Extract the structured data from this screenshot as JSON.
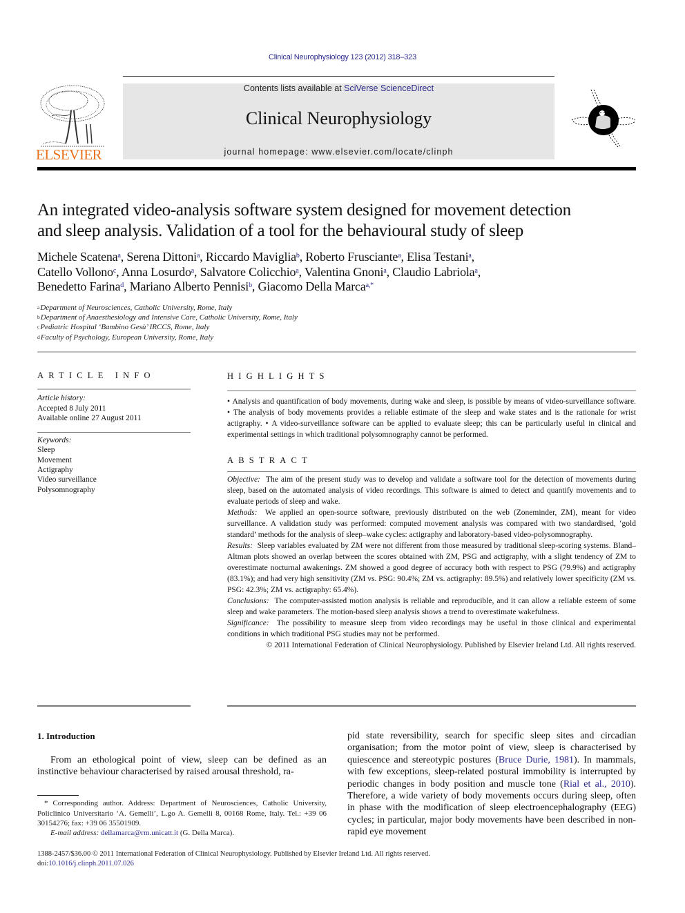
{
  "header": {
    "journal_ref": "Clinical Neurophysiology 123 (2012) 318–323",
    "publisher_logo_text": "ELSEVIER",
    "contents_prefix": "Contents lists available at ",
    "contents_link": "SciVerse ScienceDirect",
    "journal_title": "Clinical Neurophysiology",
    "homepage_prefix": "journal homepage: ",
    "homepage_url_text": "www.elsevier.com/locate/clinph"
  },
  "article": {
    "title_line1": "An integrated video-analysis software system designed for movement detection",
    "title_line2": "and sleep analysis. Validation of a tool for the behavioural study of sleep",
    "authors": [
      {
        "name": "Michele Scatena",
        "aff": "a",
        "sep": ", "
      },
      {
        "name": "Serena Dittoni",
        "aff": "a",
        "sep": ", "
      },
      {
        "name": "Riccardo Maviglia",
        "aff": "b",
        "sep": ", "
      },
      {
        "name": "Roberto Frusciante",
        "aff": "a",
        "sep": ", "
      },
      {
        "name": "Elisa Testani",
        "aff": "a",
        "sep": ","
      },
      {
        "name": "Catello Vollono",
        "aff": "c",
        "sep": ", "
      },
      {
        "name": "Anna Losurdo",
        "aff": "a",
        "sep": ", "
      },
      {
        "name": "Salvatore Colicchio",
        "aff": "a",
        "sep": ", "
      },
      {
        "name": "Valentina Gnoni",
        "aff": "a",
        "sep": ", "
      },
      {
        "name": "Claudio Labriola",
        "aff": "a",
        "sep": ","
      },
      {
        "name": "Benedetto Farina",
        "aff": "d",
        "sep": ", "
      },
      {
        "name": "Mariano Alberto Pennisi",
        "aff": "b",
        "sep": ", "
      },
      {
        "name": "Giacomo Della Marca",
        "aff": "a,*",
        "sep": ""
      }
    ],
    "affiliations": [
      {
        "key": "a",
        "text": "Department of Neurosciences, Catholic University, Rome, Italy"
      },
      {
        "key": "b",
        "text": "Department of Anaesthesiology and Intensive Care, Catholic University, Rome, Italy"
      },
      {
        "key": "c",
        "text": "Pediatric Hospital ‘Bambino Gesù’ IRCCS, Rome, Italy"
      },
      {
        "key": "d",
        "text": "Faculty of Psychology, European University, Rome, Italy"
      }
    ]
  },
  "article_info": {
    "heading": "ARTICLE INFO",
    "history_label": "Article history:",
    "accepted": "Accepted 8 July 2011",
    "online": "Available online 27 August 2011",
    "keywords_label": "Keywords:",
    "keywords": [
      "Sleep",
      "Movement",
      "Actigraphy",
      "Video surveillance",
      "Polysomnography"
    ]
  },
  "highlights": {
    "heading": "HIGHLIGHTS",
    "items": [
      "Analysis and quantification of body movements, during wake and sleep, is possible by means of video-surveillance software.",
      "The analysis of body movements provides a reliable estimate of the sleep and wake states and is the rationale for wrist actigraphy.",
      "A video-surveillance software can be applied to evaluate sleep; this can be particularly useful in clinical and experimental settings in which traditional polysomnography cannot be performed."
    ]
  },
  "abstract": {
    "heading": "ABSTRACT",
    "sections": [
      {
        "label": "Objective:",
        "text": "The aim of the present study was to develop and validate a software tool for the detection of movements during sleep, based on the automated analysis of video recordings. This software is aimed to detect and quantify movements and to evaluate periods of sleep and wake."
      },
      {
        "label": "Methods:",
        "text": "We applied an open-source software, previously distributed on the web (Zoneminder, ZM), meant for video surveillance. A validation study was performed: computed movement analysis was compared with two standardised, ‘gold standard’ methods for the analysis of sleep–wake cycles: actigraphy and laboratory-based video-polysomnography."
      },
      {
        "label": "Results:",
        "text": "Sleep variables evaluated by ZM were not different from those measured by traditional sleep-scoring systems. Bland–Altman plots showed an overlap between the scores obtained with ZM, PSG and actigraphy, with a slight tendency of ZM to overestimate nocturnal awakenings. ZM showed a good degree of accuracy both with respect to PSG (79.9%) and actigraphy (83.1%); and had very high sensitivity (ZM vs. PSG: 90.4%; ZM vs. actigraphy: 89.5%) and relatively lower specificity (ZM vs. PSG: 42.3%; ZM vs. actigraphy: 65.4%)."
      },
      {
        "label": "Conclusions:",
        "text": "The computer-assisted motion analysis is reliable and reproducible, and it can allow a reliable esteem of some sleep and wake parameters. The motion-based sleep analysis shows a trend to overestimate wakefulness."
      },
      {
        "label": "Significance:",
        "text": "The possibility to measure sleep from video recordings may be useful in those clinical and experimental conditions in which traditional PSG studies may not be performed."
      }
    ],
    "copyright": "© 2011 International Federation of Clinical Neurophysiology. Published by Elsevier Ireland Ltd. All rights reserved."
  },
  "introduction": {
    "heading": "1. Introduction",
    "left_para": "From an ethological point of view, sleep can be defined as an instinctive behaviour characterised by raised arousal threshold, ra-",
    "right_parts": {
      "p1": "pid state reversibility, search for specific sleep sites and circadian organisation; from the motor point of view, sleep is characterised by quiescence and stereotypic postures (",
      "ref1": "Bruce Durie, 1981",
      "p2": "). In mammals, with few exceptions, sleep-related postural immobility is interrupted by periodic changes in body position and muscle tone (",
      "ref2": "Rial et al., 2010",
      "p3": "). Therefore, a wide variety of body movements occurs during sleep, often in phase with the modification of sleep electroencephalography (EEG) cycles; in particular, major body movements have been described in non-rapid eye movement"
    }
  },
  "footnote": {
    "corresponding": "* Corresponding author. Address: Department of Neurosciences, Catholic University, Policlinico Universitario ‘A. Gemelli’, L.go A. Gemelli 8, 00168 Rome, Italy. Tel.: +39 06 30154276; fax: +39 06 35501909.",
    "email_label": "E-mail address:",
    "email": "dellamarca@rm.unicatt.it",
    "email_suffix": " (G. Della Marca)."
  },
  "footer": {
    "issn_line": "1388-2457/$36.00 © 2011 International Federation of Clinical Neurophysiology. Published by Elsevier Ireland Ltd. All rights reserved.",
    "doi_prefix": "doi:",
    "doi": "10.1016/j.clinph.2011.07.026"
  },
  "colors": {
    "link": "#2a2a8c",
    "elsevier_orange": "#e9711c",
    "masthead_bg": "#e6e6e6"
  }
}
